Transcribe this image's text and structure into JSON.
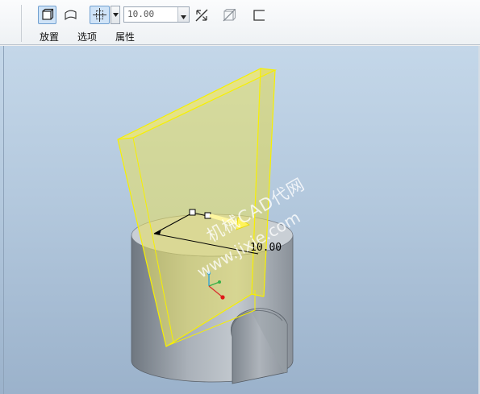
{
  "toolbar": {
    "buttons": [
      {
        "name": "solid-extrude-icon",
        "pressed": true
      },
      {
        "name": "surface-extrude-icon",
        "pressed": false
      },
      {
        "name": "depth-blind-icon",
        "pressed": true
      },
      {
        "name": "chevron-down-icon",
        "pressed": false
      },
      {
        "name": "flip-direction-icon",
        "pressed": false
      },
      {
        "name": "remove-material-icon",
        "pressed": false
      },
      {
        "name": "thicken-sketch-icon",
        "pressed": false
      }
    ],
    "depth_value": "10.00",
    "tabs": [
      {
        "label": "放置"
      },
      {
        "label": "选项"
      },
      {
        "label": "属性"
      }
    ]
  },
  "viewport": {
    "dimension_label": "10.00",
    "watermark_line1": "机械CAD代网",
    "watermark_line2": "www.jixie.com"
  },
  "colors": {
    "extrude_preview": "#e8e060",
    "extrude_edge": "#f7f000",
    "part_gray": "#a4abb3",
    "viewport_top": "#c4d7e9",
    "viewport_bottom": "#9bb2cb"
  }
}
